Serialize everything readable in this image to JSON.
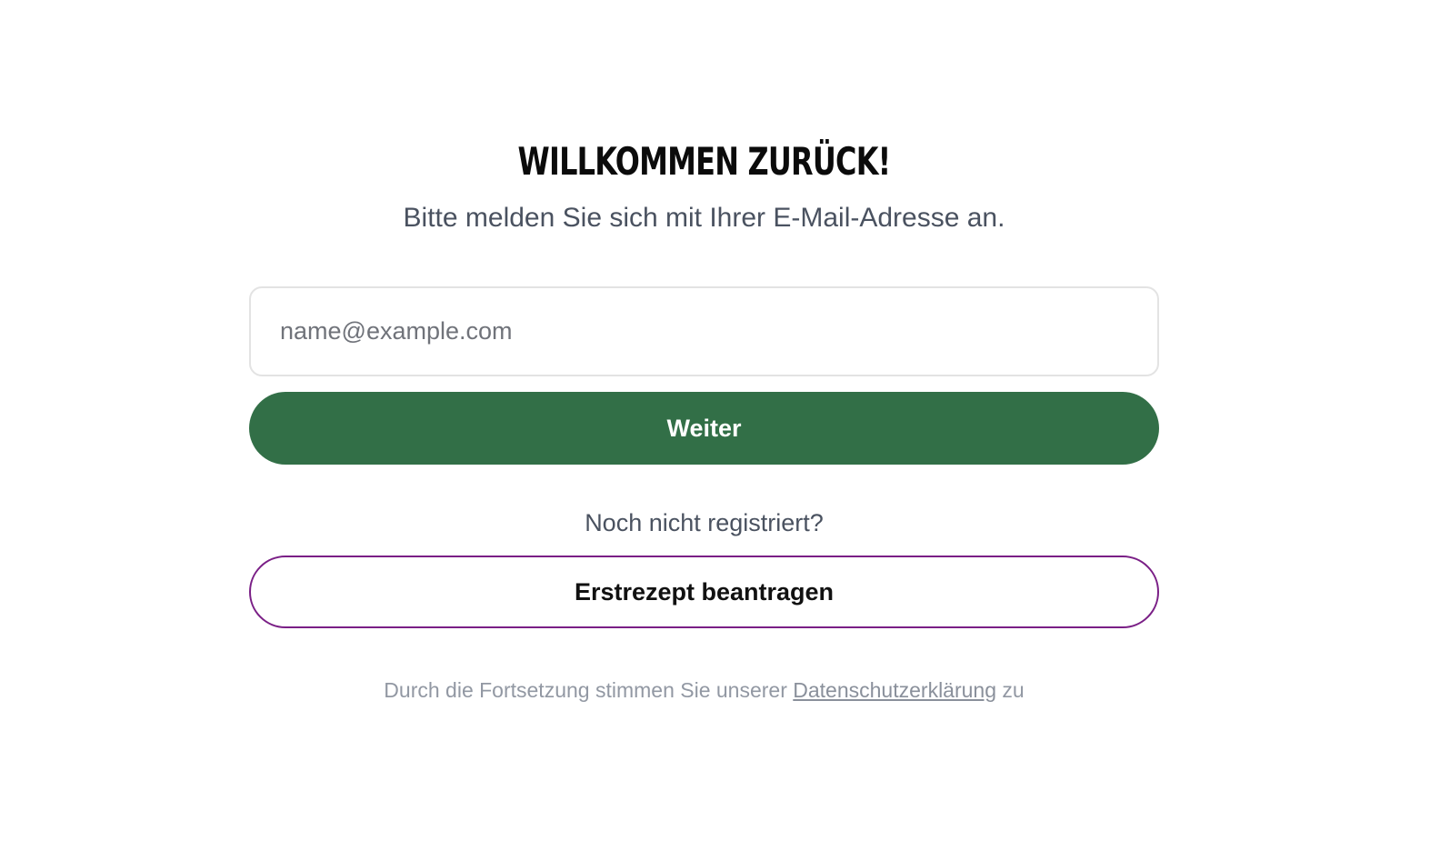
{
  "login": {
    "title": "WILLKOMMEN ZURÜCK!",
    "subtitle": "Bitte melden Sie sich mit Ihrer E-Mail-Adresse an.",
    "email_value": "",
    "email_placeholder": "name@example.com",
    "continue_label": "Weiter"
  },
  "register": {
    "prompt": "Noch nicht registriert?",
    "button_label": "Erstrezept beantragen"
  },
  "footer": {
    "consent_prefix": "Durch die Fortsetzung stimmen Sie unserer ",
    "privacy_link": "Datenschutzerklärung",
    "consent_suffix": " zu"
  },
  "colors": {
    "primary_button": "#326f47",
    "secondary_button_border": "#7a1f86",
    "muted_text": "#4a5260"
  }
}
